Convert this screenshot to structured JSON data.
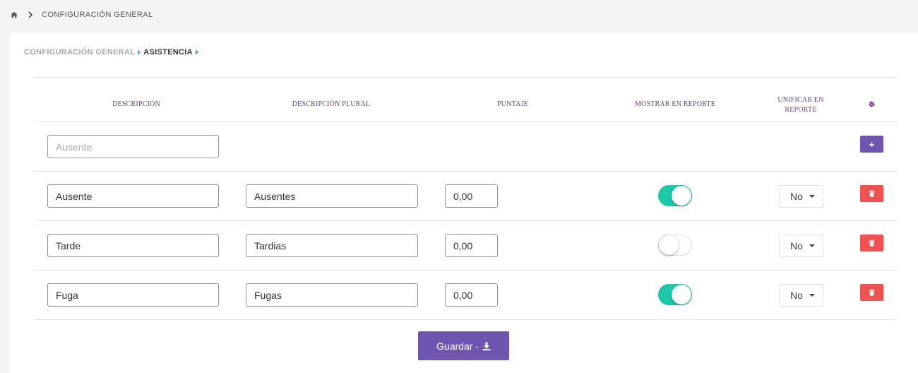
{
  "topbar": {
    "crumb": "CONFIGURACIÓN GENERAL",
    "home_icon": "home-icon",
    "chevron_icon": "chevron-right-icon"
  },
  "breadcrumb": {
    "items": [
      "CONFIGURACIÓN GENERAL",
      "ASISTENCIA"
    ]
  },
  "table": {
    "headers": {
      "descripcion": "DESCRIPCIÓN",
      "descripcion_plural": "DESCRIPCIÓN PLURAL",
      "puntaje": "PUNTAJE",
      "mostrar": "MOSTRAR EN REPORTE",
      "unificar_line1": "UNIFICAR EN",
      "unificar_line2": "REPORTE",
      "settings_icon": "gear-icon"
    },
    "new_row": {
      "placeholder": "Ausente",
      "add_label": "+"
    },
    "rows": [
      {
        "descripcion": "Ausente",
        "plural": "Ausentes",
        "puntaje": "0,00",
        "mostrar": true,
        "unificar": "No"
      },
      {
        "descripcion": "Tarde",
        "plural": "Tardias",
        "puntaje": "0,00",
        "mostrar": false,
        "unificar": "No"
      },
      {
        "descripcion": "Fuga",
        "plural": "Fugas",
        "puntaje": "0,00",
        "mostrar": true,
        "unificar": "No"
      }
    ]
  },
  "actions": {
    "save_label": "Guardar -",
    "save_icon": "download-icon"
  },
  "colors": {
    "primary": "#6f55b0",
    "toggle_on": "#1dc8a9",
    "danger": "#f0534f",
    "header_text": "#6b3f8f",
    "breadcrumb_marker": "#4aa3d8"
  }
}
